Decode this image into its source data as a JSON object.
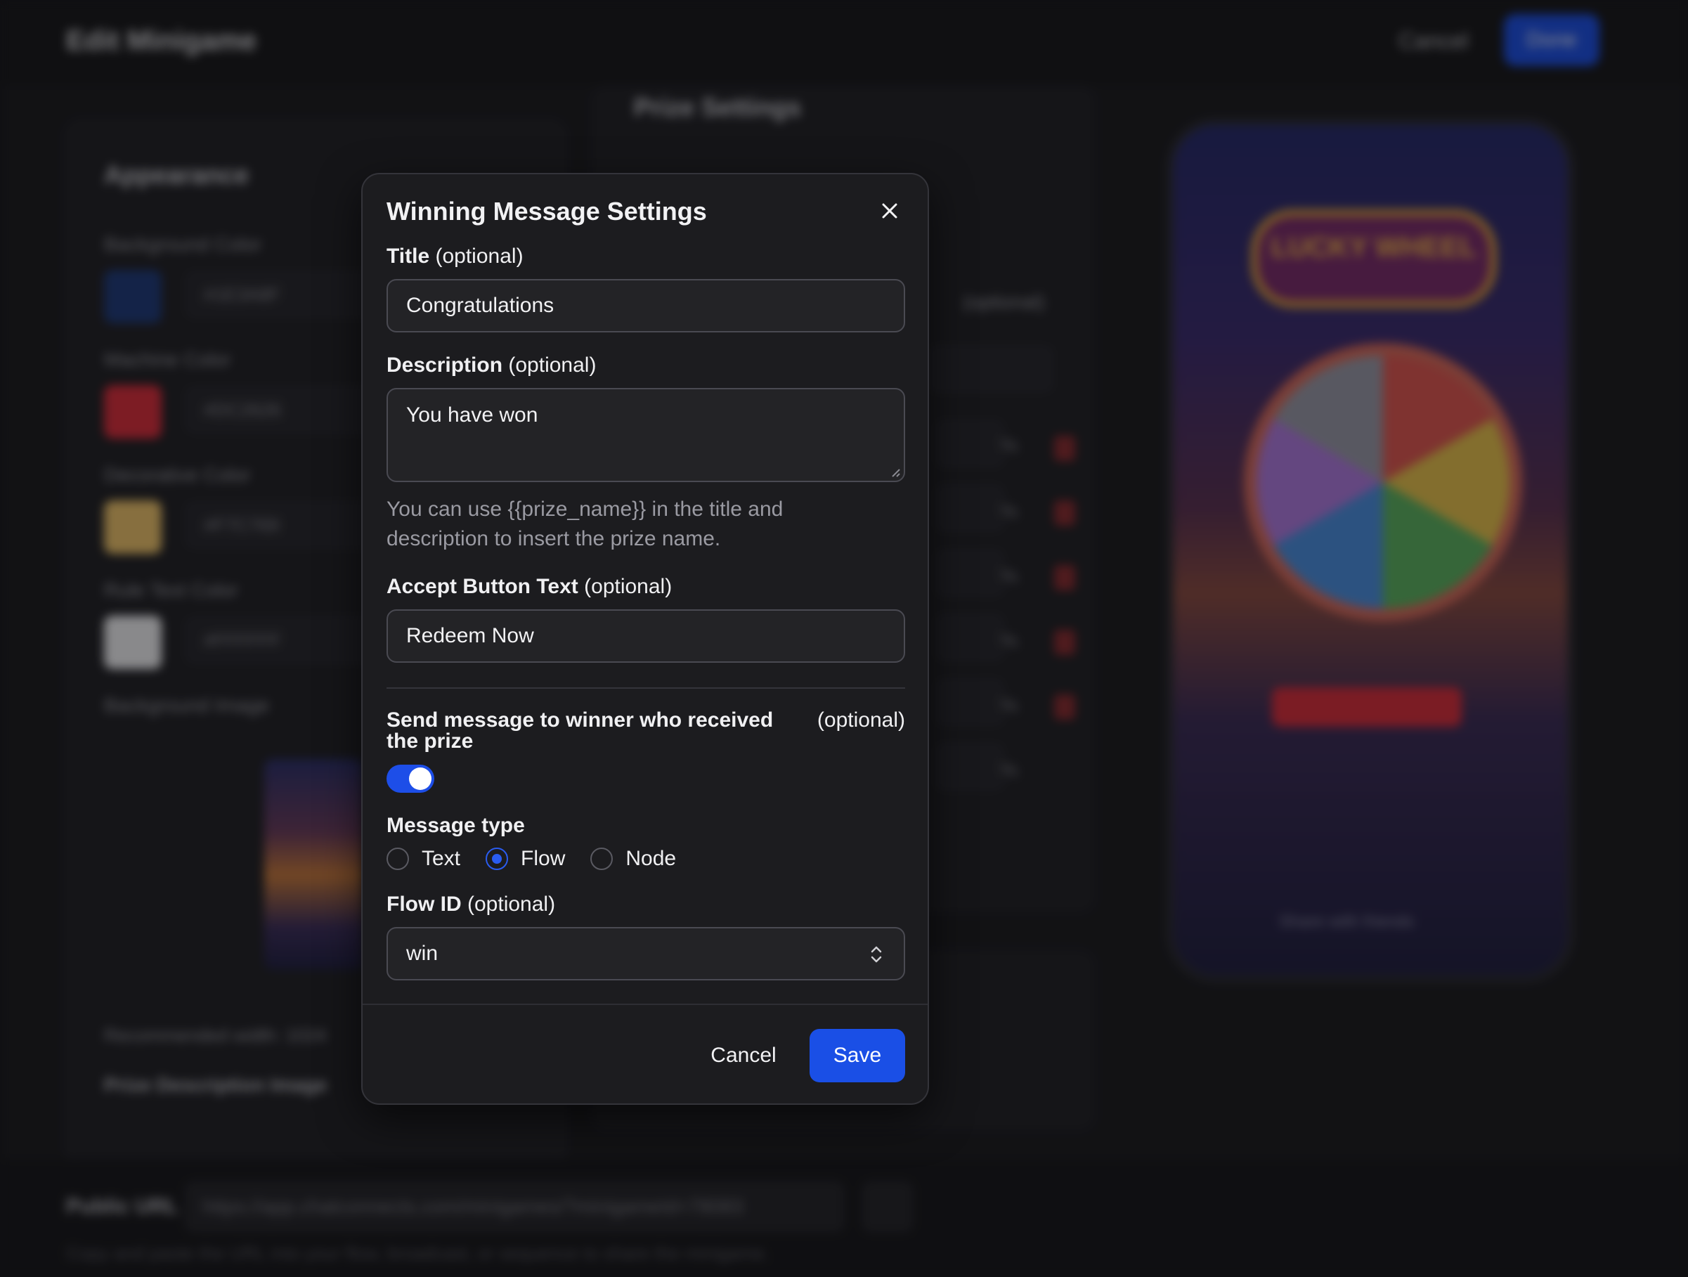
{
  "background": {
    "app_title": "Edit Minigame",
    "header_cancel": "Cancel",
    "header_done": "Done",
    "appearance_heading": "Appearance",
    "prize_settings_heading": "Prize Settings",
    "optional_hint": "(optional)",
    "colors": [
      {
        "label": "Background Color",
        "hex": "#1E3A8F",
        "swatch": "#1e3a7a"
      },
      {
        "label": "Machine Color",
        "hex": "#DC2626",
        "swatch": "#dc2c3a"
      },
      {
        "label": "Decorative Color",
        "hex": "#F7C769",
        "swatch": "#efc46a"
      },
      {
        "label": "Rule Text Color",
        "hex": "#FFFFFF",
        "swatch": "#f2f2f4"
      }
    ],
    "background_image_label": "Background Image",
    "recommended_width": "Recommended width: 1024",
    "prize_description_image": "Prize Description Image",
    "phone_title": "LUCKY WHEEL",
    "phone_share": "Share with friends",
    "public_url_label": "Public URL",
    "public_url": "https://app.chatconnects.com/minigames/?minigameId=78083",
    "public_url_hint": "Copy and paste the URL into your flow, broadcast, or sequence to share the minigame."
  },
  "modal": {
    "title": "Winning Message Settings",
    "title_field": {
      "label": "Title",
      "optional": "(optional)",
      "value": "Congratulations"
    },
    "description_field": {
      "label": "Description",
      "optional": "(optional)",
      "value": "You have won"
    },
    "hint": "You can use {{prize_name}} in the title and description to insert the prize name.",
    "accept_field": {
      "label": "Accept Button Text",
      "optional": "(optional)",
      "value": "Redeem Now"
    },
    "send_message": {
      "label": "Send message to winner who received the prize",
      "optional": "(optional)",
      "enabled": true
    },
    "message_type": {
      "label": "Message type",
      "options": [
        "Text",
        "Flow",
        "Node"
      ],
      "selected": "Flow"
    },
    "flow_id": {
      "label": "Flow ID",
      "optional": "(optional)",
      "value": "win"
    },
    "cancel_label": "Cancel",
    "save_label": "Save"
  },
  "colors": {
    "accent": "#1a4fe6",
    "modal_bg": "#1c1c1f",
    "page_bg": "#151518"
  }
}
